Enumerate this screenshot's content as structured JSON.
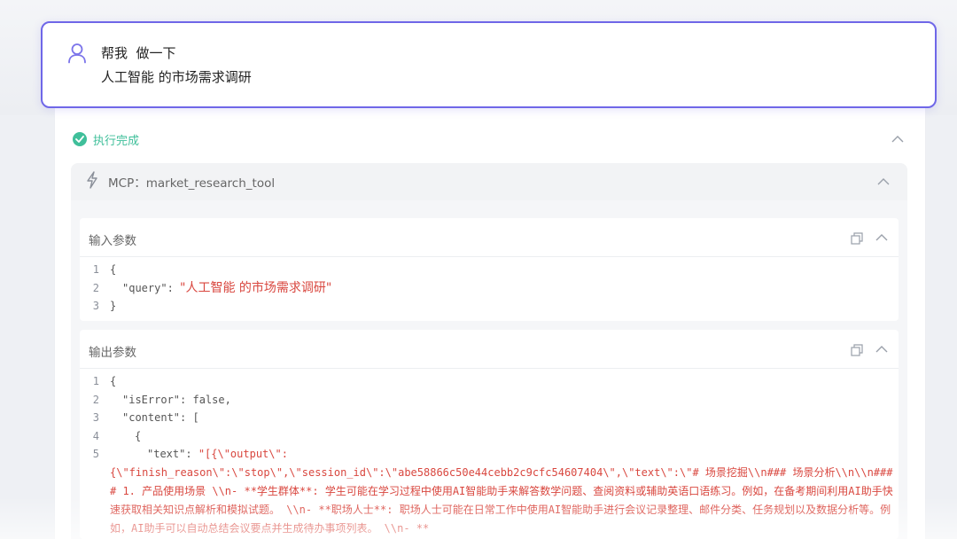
{
  "prompt": {
    "line1": "帮我  做一下",
    "line2": "人工智能 的市场需求调研"
  },
  "status": {
    "text": "执行完成",
    "color": "#3fbf9a"
  },
  "tool": {
    "title": "MCP：market_research_tool"
  },
  "input_section": {
    "title": "输入参数",
    "lines": [
      {
        "num": "1",
        "text": "{"
      },
      {
        "num": "2",
        "key": "\"query\"",
        "sep": ": ",
        "value": "\"人工智能 的市场需求调研\""
      },
      {
        "num": "3",
        "text": "}"
      }
    ]
  },
  "output_section": {
    "title": "输出参数",
    "lines": [
      {
        "num": "1",
        "text": "{"
      },
      {
        "num": "2",
        "key": "\"isError\"",
        "sep": ": ",
        "plain": "false,"
      },
      {
        "num": "3",
        "key": "\"content\"",
        "sep": ": ",
        "plain": "["
      },
      {
        "num": "4",
        "text": "{"
      },
      {
        "num": "5",
        "key": "\"text\"",
        "sep": ": ",
        "value": "\"[{\\\"output\\\":"
      }
    ],
    "continuation": "{\\\"finish_reason\\\":\\\"stop\\\",\\\"session_id\\\":\\\"abe58866c50e44cebb2c9cfc54607404\\\",\\\"text\\\":\\\"# 场景挖掘\\\\n### 场景分析\\\\n\\\\n#### 1. 产品使用场景   \\\\n- **学生群体**: 学生可能在学习过程中使用AI智能助手来解答数学问题、查阅资料或辅助英语口语练习。例如，在备考期间利用AI助手快速获取相关知识点解析和模拟试题。   \\\\n- **职场人士**: 职场人士可能在日常工作中使用AI智能助手进行会议记录整理、邮件分类、任务规划以及数据分析等。例如，AI助手可以自动总结会议要点并生成待办事项列表。   \\\\n- **"
  },
  "colors": {
    "accent": "#6f67e8",
    "string": "#d9473f",
    "success": "#3fbf9a"
  },
  "icons": {
    "user": "user-icon",
    "check": "check-circle-icon",
    "bolt": "bolt-icon",
    "copy": "copy-icon",
    "chevron": "chevron-up-icon"
  }
}
